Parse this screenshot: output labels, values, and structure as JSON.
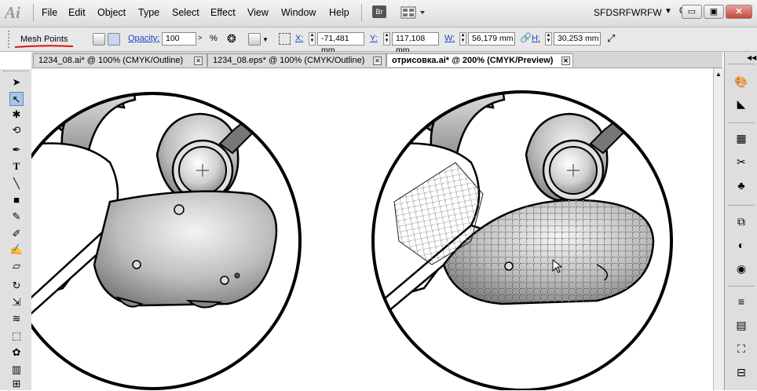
{
  "app": {
    "logo": "Ai"
  },
  "menu": {
    "items": [
      "File",
      "Edit",
      "Object",
      "Type",
      "Select",
      "Effect",
      "View",
      "Window",
      "Help"
    ]
  },
  "toolbar": {
    "bridge_label": "Br",
    "workspace_name": "SFDSRFWRFW"
  },
  "window": {
    "minimize": "▭",
    "restore": "▣",
    "close": "✕"
  },
  "control": {
    "mode_label": "Mesh Points",
    "opacity_label": "Opacity:",
    "opacity_value": "100",
    "opacity_unit": "%",
    "x_label": "X:",
    "x_value": "-71,481 mm",
    "y_label": "Y:",
    "y_value": "117,108 mm",
    "w_label": "W:",
    "w_value": "56,179 mm",
    "h_label": "H:",
    "h_value": "30,253 mm"
  },
  "tabs": [
    {
      "label": "1234_08.ai* @ 100% (CMYK/Outline)",
      "active": false
    },
    {
      "label": "1234_08.eps* @ 100% (CMYK/Outline)",
      "active": false
    },
    {
      "label": "отрисовка.ai* @ 200% (CMYK/Preview)",
      "active": true
    }
  ],
  "tools": [
    "selection",
    "direct-selection",
    "magic-wand",
    "lasso",
    "pen",
    "type",
    "line",
    "rectangle",
    "paintbrush",
    "pencil",
    "blob-brush",
    "eraser",
    "rotate",
    "scale",
    "warp",
    "free-transform",
    "symbol-sprayer",
    "graph",
    "mesh"
  ],
  "right_panels": [
    "color",
    "color-guide",
    "swatches",
    "brushes",
    "symbols",
    "graphic-styles",
    "appearance",
    "layers",
    "stroke",
    "gradient",
    "transparency",
    "align",
    "pathfinder"
  ],
  "colors": {
    "accent": "#1a45c8",
    "mark": "#e01010",
    "selection": "#a9c4e6"
  }
}
